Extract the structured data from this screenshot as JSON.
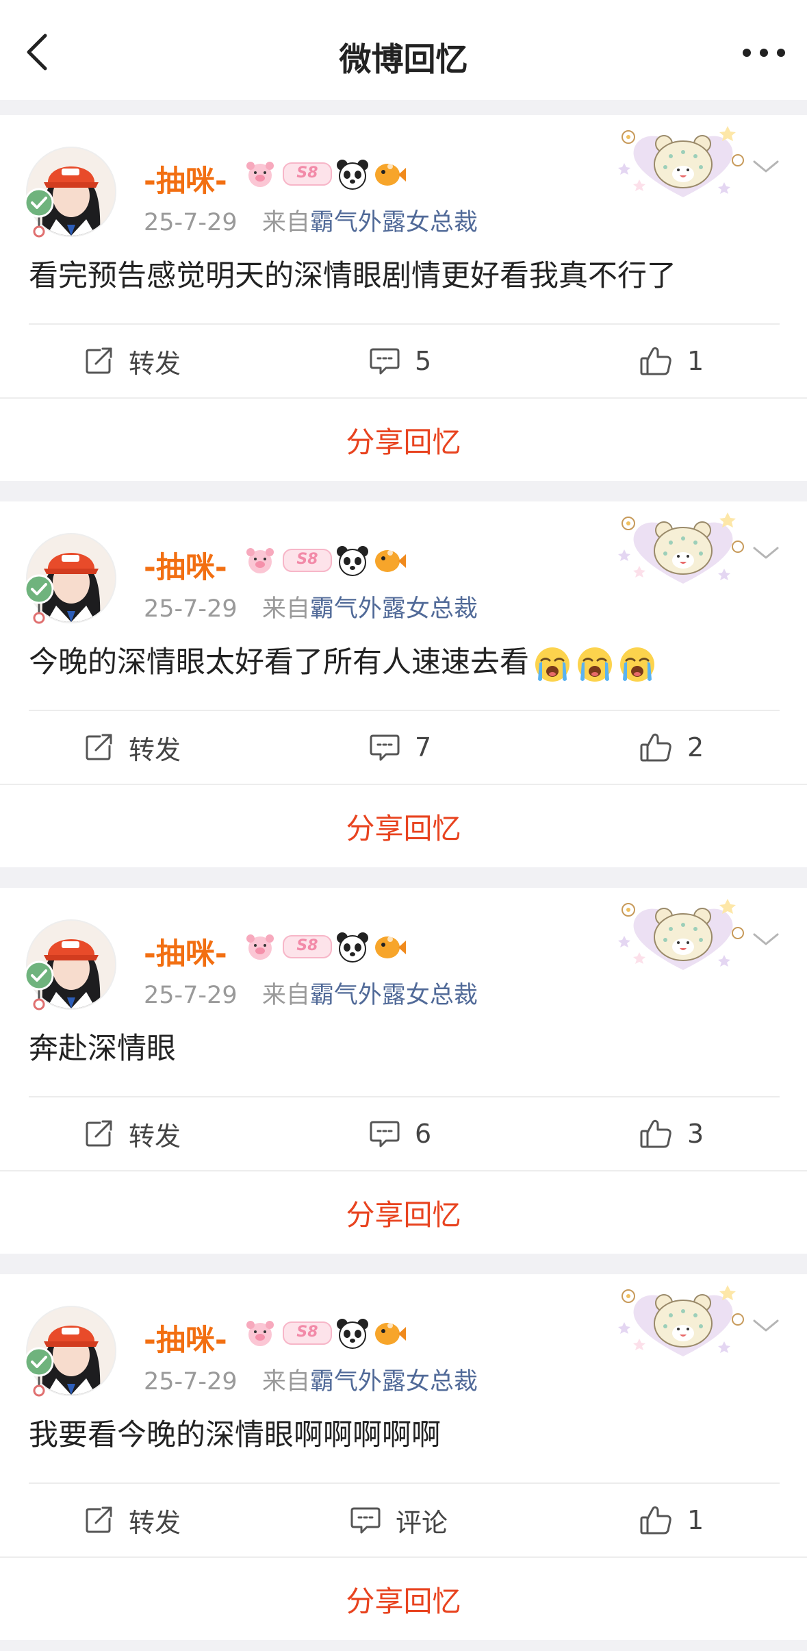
{
  "nav": {
    "title": "微博回忆",
    "back_icon": "chevron-left-icon",
    "more_icon": "ellipsis-icon"
  },
  "colors": {
    "username": "#f26f12",
    "share": "#e8431f",
    "source": "#516a98",
    "meta": "#9a9a9a"
  },
  "posts": [
    {
      "username": "-抽咪-",
      "date": "25-7-29",
      "from_label": "来自",
      "source": "霸气外露女总裁",
      "text": "看完预告感觉明天的深情眼剧情更好看我真不行了",
      "repost_label": "转发",
      "comment_label": "5",
      "like_label": "1",
      "share_label": "分享回忆",
      "badges": [
        "pink-pig-badge",
        "level-badge",
        "panda-icon",
        "fish-icon"
      ],
      "badge_level": "S8",
      "emoji_count": 0
    },
    {
      "username": "-抽咪-",
      "date": "25-7-29",
      "from_label": "来自",
      "source": "霸气外露女总裁",
      "text": "今晚的深情眼太好看了所有人速速去看",
      "repost_label": "转发",
      "comment_label": "7",
      "like_label": "2",
      "share_label": "分享回忆",
      "badges": [
        "pink-pig-badge",
        "level-badge",
        "panda-icon",
        "fish-icon"
      ],
      "badge_level": "S8",
      "emoji_count": 3
    },
    {
      "username": "-抽咪-",
      "date": "25-7-29",
      "from_label": "来自",
      "source": "霸气外露女总裁",
      "text": "奔赴深情眼",
      "repost_label": "转发",
      "comment_label": "6",
      "like_label": "3",
      "share_label": "分享回忆",
      "badges": [
        "pink-pig-badge",
        "level-badge",
        "panda-icon",
        "fish-icon"
      ],
      "badge_level": "S8",
      "emoji_count": 0
    },
    {
      "username": "-抽咪-",
      "date": "25-7-29",
      "from_label": "来自",
      "source": "霸气外露女总裁",
      "text": "我要看今晚的深情眼啊啊啊啊啊",
      "repost_label": "转发",
      "comment_label": "评论",
      "like_label": "1",
      "share_label": "分享回忆",
      "badges": [
        "pink-pig-badge",
        "level-badge",
        "panda-icon",
        "fish-icon"
      ],
      "badge_level": "S8",
      "emoji_count": 0
    }
  ]
}
